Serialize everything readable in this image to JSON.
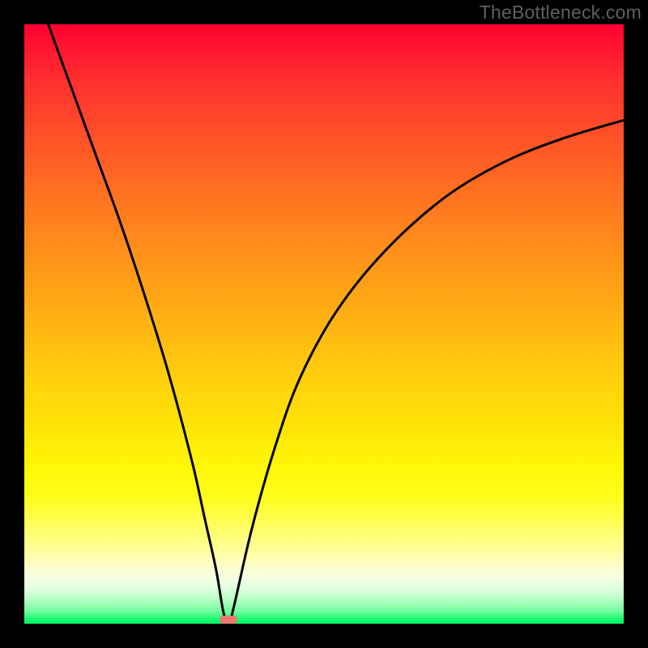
{
  "watermark": "TheBottleneck.com",
  "chart_data": {
    "type": "line",
    "title": "",
    "xlabel": "",
    "ylabel": "",
    "xlim": [
      0,
      100
    ],
    "ylim": [
      0,
      100
    ],
    "grid": false,
    "legend": false,
    "background_gradient": {
      "direction": "vertical",
      "stops": [
        {
          "pos": 0.0,
          "color": "#ff0030"
        },
        {
          "pos": 0.1,
          "color": "#ff2e2f"
        },
        {
          "pos": 0.25,
          "color": "#ff6a22"
        },
        {
          "pos": 0.45,
          "color": "#ffab14"
        },
        {
          "pos": 0.65,
          "color": "#ffe408"
        },
        {
          "pos": 0.8,
          "color": "#fffe55"
        },
        {
          "pos": 0.9,
          "color": "#ffffc2"
        },
        {
          "pos": 0.96,
          "color": "#b5ffc4"
        },
        {
          "pos": 1.0,
          "color": "#00f860"
        }
      ]
    },
    "series": [
      {
        "name": "bottleneck-curve",
        "color": "#000000",
        "x": [
          4,
          8,
          12,
          16,
          20,
          24,
          28,
          30,
          32,
          33.2,
          34.1,
          35,
          38,
          42,
          46,
          52,
          60,
          70,
          80,
          90,
          100
        ],
        "y": [
          100,
          89,
          78,
          67,
          55,
          42,
          27,
          18,
          9,
          2,
          0,
          3,
          16,
          30,
          41,
          52,
          62,
          71,
          77,
          81,
          84
        ]
      }
    ],
    "annotations": [
      {
        "name": "minimum-marker",
        "shape": "pill",
        "color": "#e97a6f",
        "x": 34.1,
        "y": 0.7
      }
    ]
  }
}
